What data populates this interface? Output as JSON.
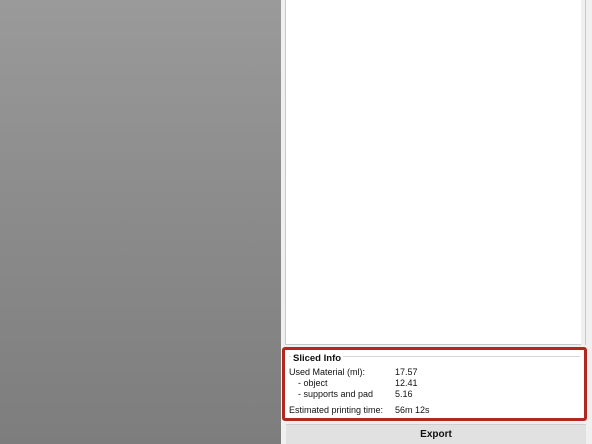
{
  "sliced_info": {
    "title": "Sliced Info",
    "rows": [
      {
        "label": "Used Material (ml):",
        "value": "17.57"
      },
      {
        "label": "- object",
        "value": "12.41"
      },
      {
        "label": "- supports and pad",
        "value": "5.16"
      },
      {
        "label": "Estimated printing time:",
        "value": "56m 12s"
      }
    ]
  },
  "actions": {
    "export_label": "Export"
  },
  "colors": {
    "highlight_border": "#b2281e",
    "viewport_gray": "#8c8c8c"
  }
}
